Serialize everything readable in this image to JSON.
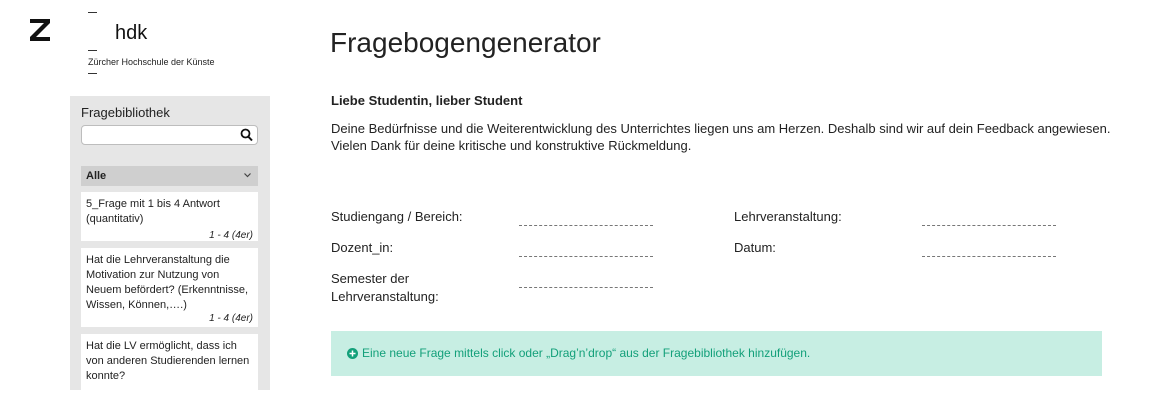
{
  "logo": {
    "mark": "Z",
    "short": "hdk",
    "full": "Zürcher Hochschule der Künste"
  },
  "sidebar": {
    "title": "Fragebibliothek",
    "search": {
      "placeholder": "",
      "value": ""
    },
    "filter": {
      "selected": "Alle"
    },
    "questions": [
      {
        "text": "5_Frage mit 1 bis 4 Antwort (quantitativ)",
        "meta": "1 - 4 (4er)"
      },
      {
        "text": "Hat die Lehrveranstaltung die Motivation zur Nutzung von Neuem befördert? (Erkenntnisse, Wissen, Können,….)",
        "meta": "1 - 4 (4er)"
      },
      {
        "text": "Hat die LV ermöglicht, dass ich von anderen Studierenden lernen konnte?",
        "meta": ""
      }
    ]
  },
  "main": {
    "title": "Fragebogengenerator",
    "greeting": "Liebe Studentin, lieber Student",
    "intro": "Deine Bedürfnisse und die Weiterentwicklung des Unterrichtes liegen uns am Herzen. Deshalb sind wir auf dein Feedback angewiesen. Vielen Dank für deine kritische und konstruktive Rückmeldung.",
    "fields": {
      "studiengang": "Studiengang / Bereich:",
      "lehrveranstaltung": "Lehrveranstaltung:",
      "dozent": "Dozent_in:",
      "datum": "Datum:",
      "semester": "Semester der Lehrveranstaltung:"
    },
    "dropzone": {
      "text": "Eine neue Frage mittels click oder „Drag’n’drop“ aus der Fragebibliothek hinzufügen."
    }
  },
  "colors": {
    "sidebar_bg": "#e6e6e6",
    "filter_bg": "#cfcfcf",
    "dropzone_bg": "#c7eee3",
    "accent": "#13a07a"
  },
  "icons": [
    "z-logo-icon",
    "search-icon",
    "chevron-down-icon",
    "plus-circle-icon"
  ]
}
